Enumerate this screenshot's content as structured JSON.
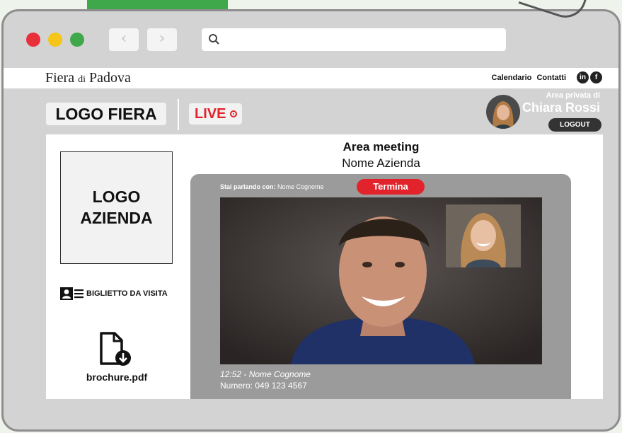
{
  "browser": {
    "traffic_lights": [
      "#e8303a",
      "#f5c518",
      "#3fa84a"
    ],
    "back_icon": "chevron-left-icon",
    "forward_icon": "chevron-right-icon",
    "back_glyph": "‹",
    "forward_glyph": "›",
    "url_value": ""
  },
  "topbar": {
    "brand_main": "Fiera",
    "brand_di": "di",
    "brand_end": "Padova",
    "nav": [
      "Calendario",
      "Contatti"
    ],
    "social": [
      "in",
      "f"
    ]
  },
  "header": {
    "logo_fiera": "LOGO FIERA",
    "live": "LIVE",
    "area_label": "Area privata di",
    "user_name": "Chiara Rossi",
    "logout": "LOGOUT"
  },
  "company": {
    "logo": "LOGO AZIENDA",
    "business_card": "BIGLIETTO DA VISITA",
    "brochure": "brochure.pdf"
  },
  "meeting": {
    "title": "Area meeting",
    "company_name": "Nome Azienda",
    "talking_label": "Stai parlando con:",
    "talking_name": "Nome Cognome",
    "end_button": "Termina",
    "call_time": "12:52 - Nome Cognome",
    "call_number": "Numero: 049 123 4567"
  },
  "colors": {
    "accent_red": "#e2232b",
    "brand_green": "#3fa84a"
  }
}
